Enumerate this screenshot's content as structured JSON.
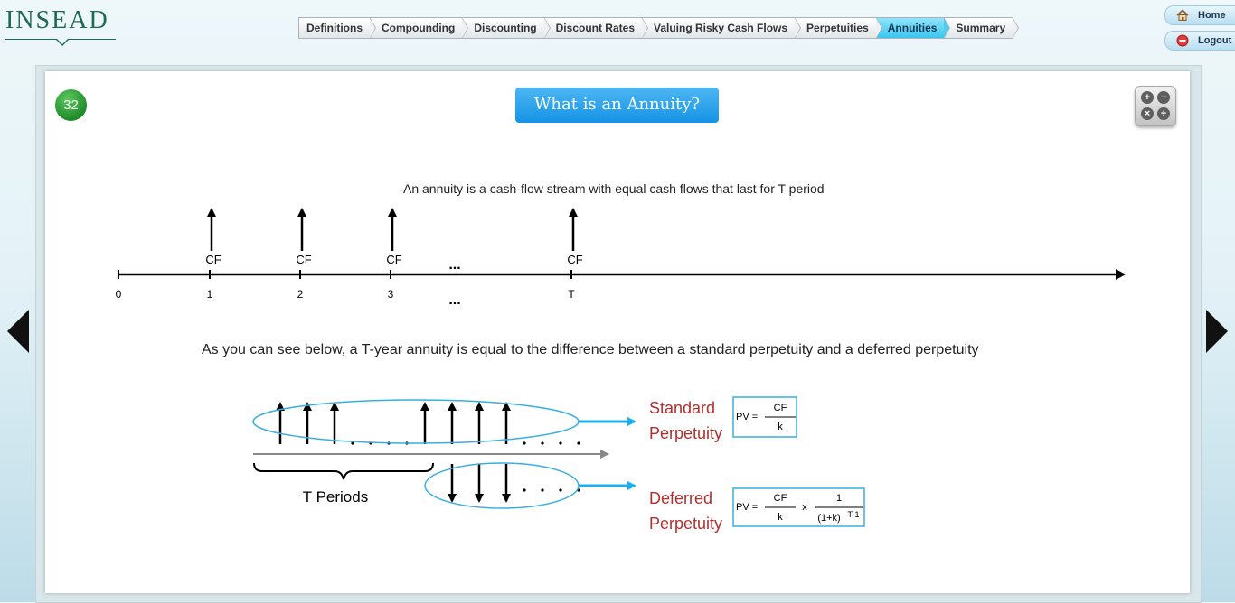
{
  "logo": {
    "text": "INSEAD"
  },
  "nav": {
    "tabs": [
      {
        "label": "Definitions",
        "active": false
      },
      {
        "label": "Compounding",
        "active": false
      },
      {
        "label": "Discounting",
        "active": false
      },
      {
        "label": "Discount Rates",
        "active": false
      },
      {
        "label": "Valuing Risky Cash Flows",
        "active": false
      },
      {
        "label": "Perpetuities",
        "active": false
      },
      {
        "label": "Annuities",
        "active": true
      },
      {
        "label": "Summary",
        "active": false
      }
    ]
  },
  "top_buttons": {
    "home": "Home",
    "logout": "Logout"
  },
  "slide": {
    "number": "32",
    "title": "What is an Annuity?",
    "intro": "An annuity is a cash-flow stream with equal cash flows that last for T period",
    "description": "As you can see below, a T-year annuity is equal to the difference between a standard perpetuity and a deferred perpetuity"
  },
  "timeline": {
    "ticks": [
      "0",
      "1",
      "2",
      "3",
      "T"
    ],
    "cf_label": "CF",
    "ellipsis": "..."
  },
  "diagram": {
    "periods_label": "T Periods",
    "standard_label_1": "Standard",
    "standard_label_2": "Perpetuity",
    "deferred_label_1": "Deferred",
    "deferred_label_2": "Perpetuity",
    "formula_pv": "PV =",
    "formula_cf": "CF",
    "formula_k": "k",
    "formula_x": "x",
    "formula_one": "1",
    "formula_denom": "(1+k)",
    "formula_exp": "T-1"
  },
  "colors": {
    "accent": "#1593e6",
    "active_tab": "#3cc6f0",
    "label_red": "#b03030",
    "ellipse": "#3aaee0"
  },
  "icons": [
    "home-icon",
    "logout-icon",
    "calculator-icon",
    "prev-arrow-icon",
    "next-arrow-icon"
  ]
}
